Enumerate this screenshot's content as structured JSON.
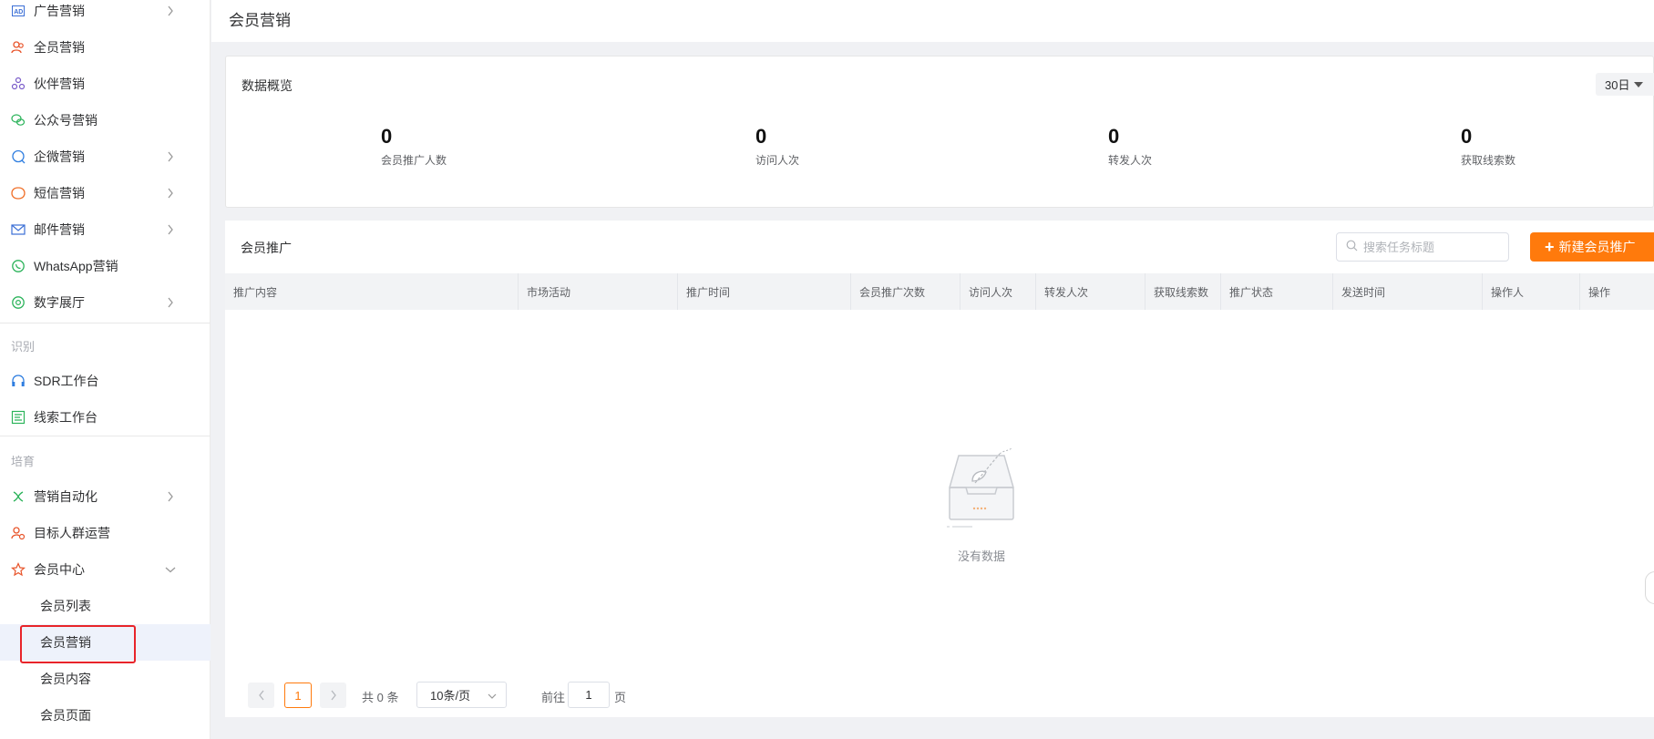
{
  "sidebar": {
    "items": [
      {
        "label": "广告营销",
        "icon": "ad-icon"
      },
      {
        "label": "全员营销",
        "icon": "people-icon"
      },
      {
        "label": "伙伴营销",
        "icon": "partner-icon"
      },
      {
        "label": "公众号营销",
        "icon": "wechat-icon"
      },
      {
        "label": "企微营销",
        "icon": "chat-icon"
      },
      {
        "label": "短信营销",
        "icon": "sms-icon"
      },
      {
        "label": "邮件营销",
        "icon": "mail-icon"
      },
      {
        "label": "WhatsApp营销",
        "icon": "whatsapp-icon"
      },
      {
        "label": "数字展厅",
        "icon": "showroom-icon"
      }
    ],
    "group_identify": "识别",
    "identify_items": [
      {
        "label": "SDR工作台",
        "icon": "headset-icon"
      },
      {
        "label": "线索工作台",
        "icon": "lead-icon"
      }
    ],
    "group_nurture": "培育",
    "nurture_items": [
      {
        "label": "营销自动化",
        "icon": "automation-icon"
      },
      {
        "label": "目标人群运营",
        "icon": "audience-icon"
      },
      {
        "label": "会员中心",
        "icon": "member-icon"
      }
    ],
    "member_sub": [
      "会员列表",
      "会员营销",
      "会员内容",
      "会员页面"
    ]
  },
  "header": {
    "title": "会员营销"
  },
  "overview": {
    "title": "数据概览",
    "period": "30日",
    "stats": [
      {
        "value": "0",
        "label": "会员推广人数"
      },
      {
        "value": "0",
        "label": "访问人次"
      },
      {
        "value": "0",
        "label": "转发人次"
      },
      {
        "value": "0",
        "label": "获取线索数"
      }
    ]
  },
  "promo": {
    "title": "会员推广",
    "search_placeholder": "搜索任务标题",
    "new_button": "新建会员推广",
    "columns": [
      "推广内容",
      "市场活动",
      "推广时间",
      "会员推广次数",
      "访问人次",
      "转发人次",
      "获取线索数",
      "推广状态",
      "发送时间",
      "操作人",
      "操作"
    ],
    "empty_text": "没有数据"
  },
  "pagination": {
    "prev": "<",
    "current": "1",
    "next": ">",
    "total": "共 0 条",
    "page_size": "10条/页",
    "goto_label": "前往",
    "goto_value": "1",
    "page_unit": "页"
  },
  "colors": {
    "accent": "#ff7a0c",
    "highlight_box": "#e8242a"
  }
}
